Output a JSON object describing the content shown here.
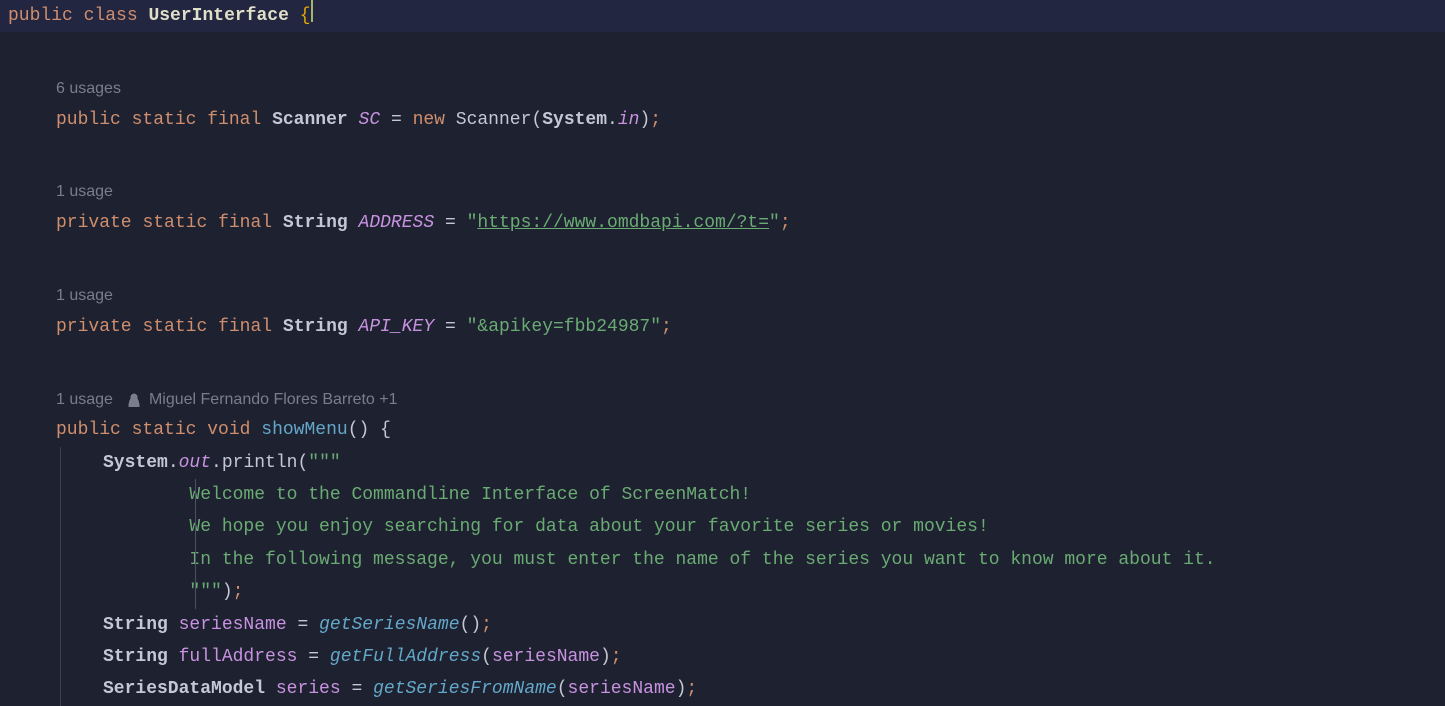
{
  "class_decl": {
    "public": "public",
    "class_kw": "class",
    "name": "UserInterface",
    "brace": "{"
  },
  "hints": {
    "sc_usages": "6 usages",
    "address_usages": "1 usage",
    "apikey_usages": "1 usage",
    "showmenu_usages": "1 usage",
    "author": "Miguel Fernando Flores Barreto +1"
  },
  "tok": {
    "public": "public",
    "private": "private",
    "static": "static",
    "final": "final",
    "void": "void",
    "new": "new",
    "Scanner": "Scanner",
    "String": "String",
    "System": "System",
    "SeriesDataModel": "SeriesDataModel",
    "SC": "SC",
    "in": "in",
    "out": "out",
    "ADDRESS": "ADDRESS",
    "API_KEY": "API_KEY",
    "showMenu": "showMenu",
    "println": "println",
    "getSeriesName": "getSeriesName",
    "getFullAddress": "getFullAddress",
    "getSeriesFromName": "getSeriesFromName",
    "seriesName": "seriesName",
    "fullAddress": "fullAddress",
    "series": "series",
    "eq": "=",
    "dot": ".",
    "lparen": "(",
    "rparen": ")",
    "lbrace": "{",
    "rbrace": "}",
    "semi": ";",
    "dq": "\"",
    "tdq_open": "\"\"\"",
    "tdq_close": "\"\"\""
  },
  "strings": {
    "address_url": "https://www.omdbapi.com/?t=",
    "apikey": "&apikey=fbb24987",
    "welcome_l1": "Welcome to the Commandline Interface of ScreenMatch!",
    "welcome_l2": "We hope you enjoy searching for data about your favorite series or movies!",
    "welcome_l3": "In the following message, you must enter the name of the series you want to know more about it."
  }
}
